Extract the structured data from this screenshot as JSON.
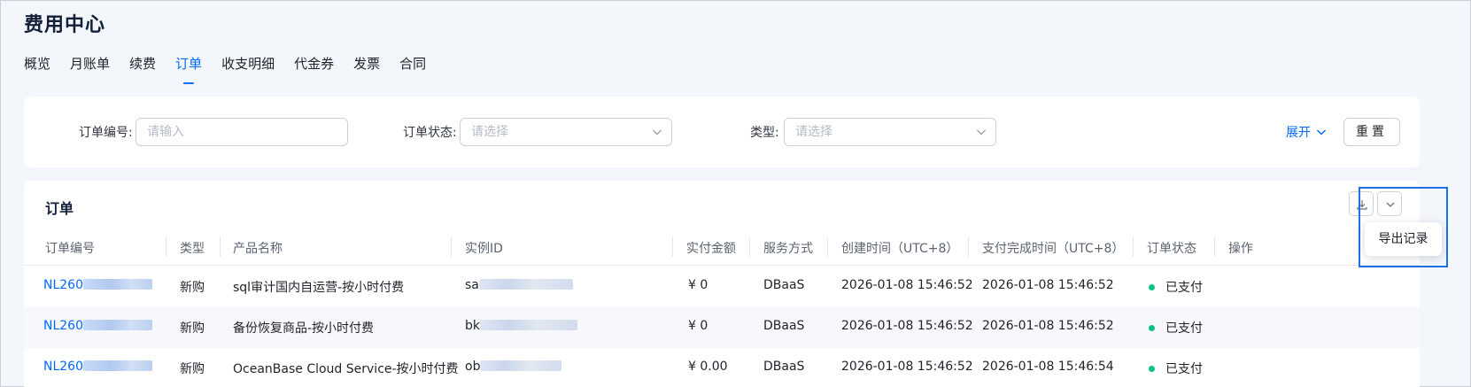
{
  "page": {
    "title": "费用中心"
  },
  "tabs": [
    {
      "label": "概览",
      "active": false
    },
    {
      "label": "月账单",
      "active": false
    },
    {
      "label": "续费",
      "active": false
    },
    {
      "label": "订单",
      "active": true
    },
    {
      "label": "收支明细",
      "active": false
    },
    {
      "label": "代金券",
      "active": false
    },
    {
      "label": "发票",
      "active": false
    },
    {
      "label": "合同",
      "active": false
    }
  ],
  "filters": {
    "order_no_label": "订单编号:",
    "order_no_placeholder": "请输入",
    "status_label": "订单状态:",
    "status_placeholder": "请选择",
    "type_label": "类型:",
    "type_placeholder": "请选择",
    "expand_label": "展开",
    "reset_label": "重置"
  },
  "table": {
    "title": "订单",
    "columns": [
      "订单编号",
      "类型",
      "产品名称",
      "实例ID",
      "实付金额",
      "服务方式",
      "创建时间（UTC+8）",
      "支付完成时间（UTC+8）",
      "订单状态",
      "操作"
    ],
    "rows": [
      {
        "order_no": "NL260",
        "type": "新购",
        "product": "sql审计国内自运营-按小时付费",
        "instance_id": "sa",
        "amount": "¥ 0",
        "service": "DBaaS",
        "created": "2026-01-08 15:46:52",
        "paid": "2026-01-08 15:46:52",
        "status": "已支付"
      },
      {
        "order_no": "NL260",
        "type": "新购",
        "product": "备份恢复商品-按小时付费",
        "instance_id": "bk",
        "amount": "¥ 0",
        "service": "DBaaS",
        "created": "2026-01-08 15:46:52",
        "paid": "2026-01-08 15:46:52",
        "status": "已支付"
      },
      {
        "order_no": "NL260",
        "type": "新购",
        "product": "OceanBase Cloud Service-按小时付费",
        "instance_id": "ob",
        "amount": "¥ 0.00",
        "service": "DBaaS",
        "created": "2026-01-08 15:46:52",
        "paid": "2026-01-08 15:46:54",
        "status": "已支付"
      }
    ]
  },
  "export_menu": {
    "item_label": "导出记录"
  },
  "colors": {
    "accent": "#006aff",
    "status_paid": "#0ac185",
    "highlight": "#1f6fe5"
  },
  "icons": [
    "chevron-down-icon",
    "download-icon"
  ]
}
